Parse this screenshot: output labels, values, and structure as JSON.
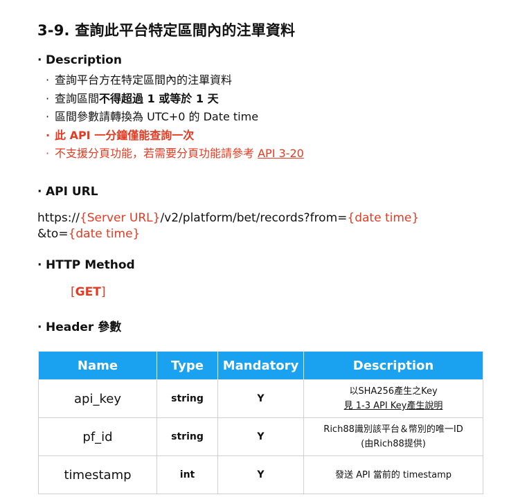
{
  "page": {
    "title": "3-9. 查詢此平台特定區間內的注單資料"
  },
  "description": {
    "heading": "Description",
    "items": [
      {
        "pre": "查詢平台方在特定區間內的注單資料",
        "bold": "",
        "post": ""
      },
      {
        "pre": "查詢區間",
        "bold": "不得超過 1 或等於 1 天",
        "post": ""
      },
      {
        "pre": "區間參數請轉換為 UTC+0 的 Date time",
        "bold": "",
        "post": ""
      },
      {
        "pre": "此 API 一分鐘僅能查詢一次",
        "bold": "",
        "post": ""
      },
      {
        "pre": "不支援分頁功能，若需要分頁功能請參考 ",
        "bold": "",
        "post": "API 3-20"
      }
    ]
  },
  "api_url": {
    "heading": "API URL",
    "line1_pre": "https://",
    "line1_server": "{Server URL}",
    "line1_path": "/v2/platform/bet/records?from=",
    "line1_date": "{date time}",
    "line2_pre": "&to=",
    "line2_date": "{date time}"
  },
  "http_method": {
    "heading": "HTTP Method",
    "open": "[",
    "value": "GET",
    "close": "]"
  },
  "header_params": {
    "heading": "Header 參數",
    "columns": [
      "Name",
      "Type",
      "Mandatory",
      "Description"
    ],
    "rows": [
      {
        "name": "api_key",
        "type": "string",
        "mandatory": "Y",
        "desc1": "以SHA256產生之Key",
        "desc2": "見 1-3 API Key產生說明"
      },
      {
        "name": "pf_id",
        "type": "string",
        "mandatory": "Y",
        "desc1": "Rich88識別該平台＆幣別的唯一ID",
        "desc2": "(由Rich88提供)"
      },
      {
        "name": "timestamp",
        "type": "int",
        "mandatory": "Y",
        "desc1": "發送 API 當前的 timestamp",
        "desc2": ""
      }
    ]
  },
  "colors": {
    "accent_red": "#e53a22",
    "table_header_blue": "#1aa1f0"
  }
}
